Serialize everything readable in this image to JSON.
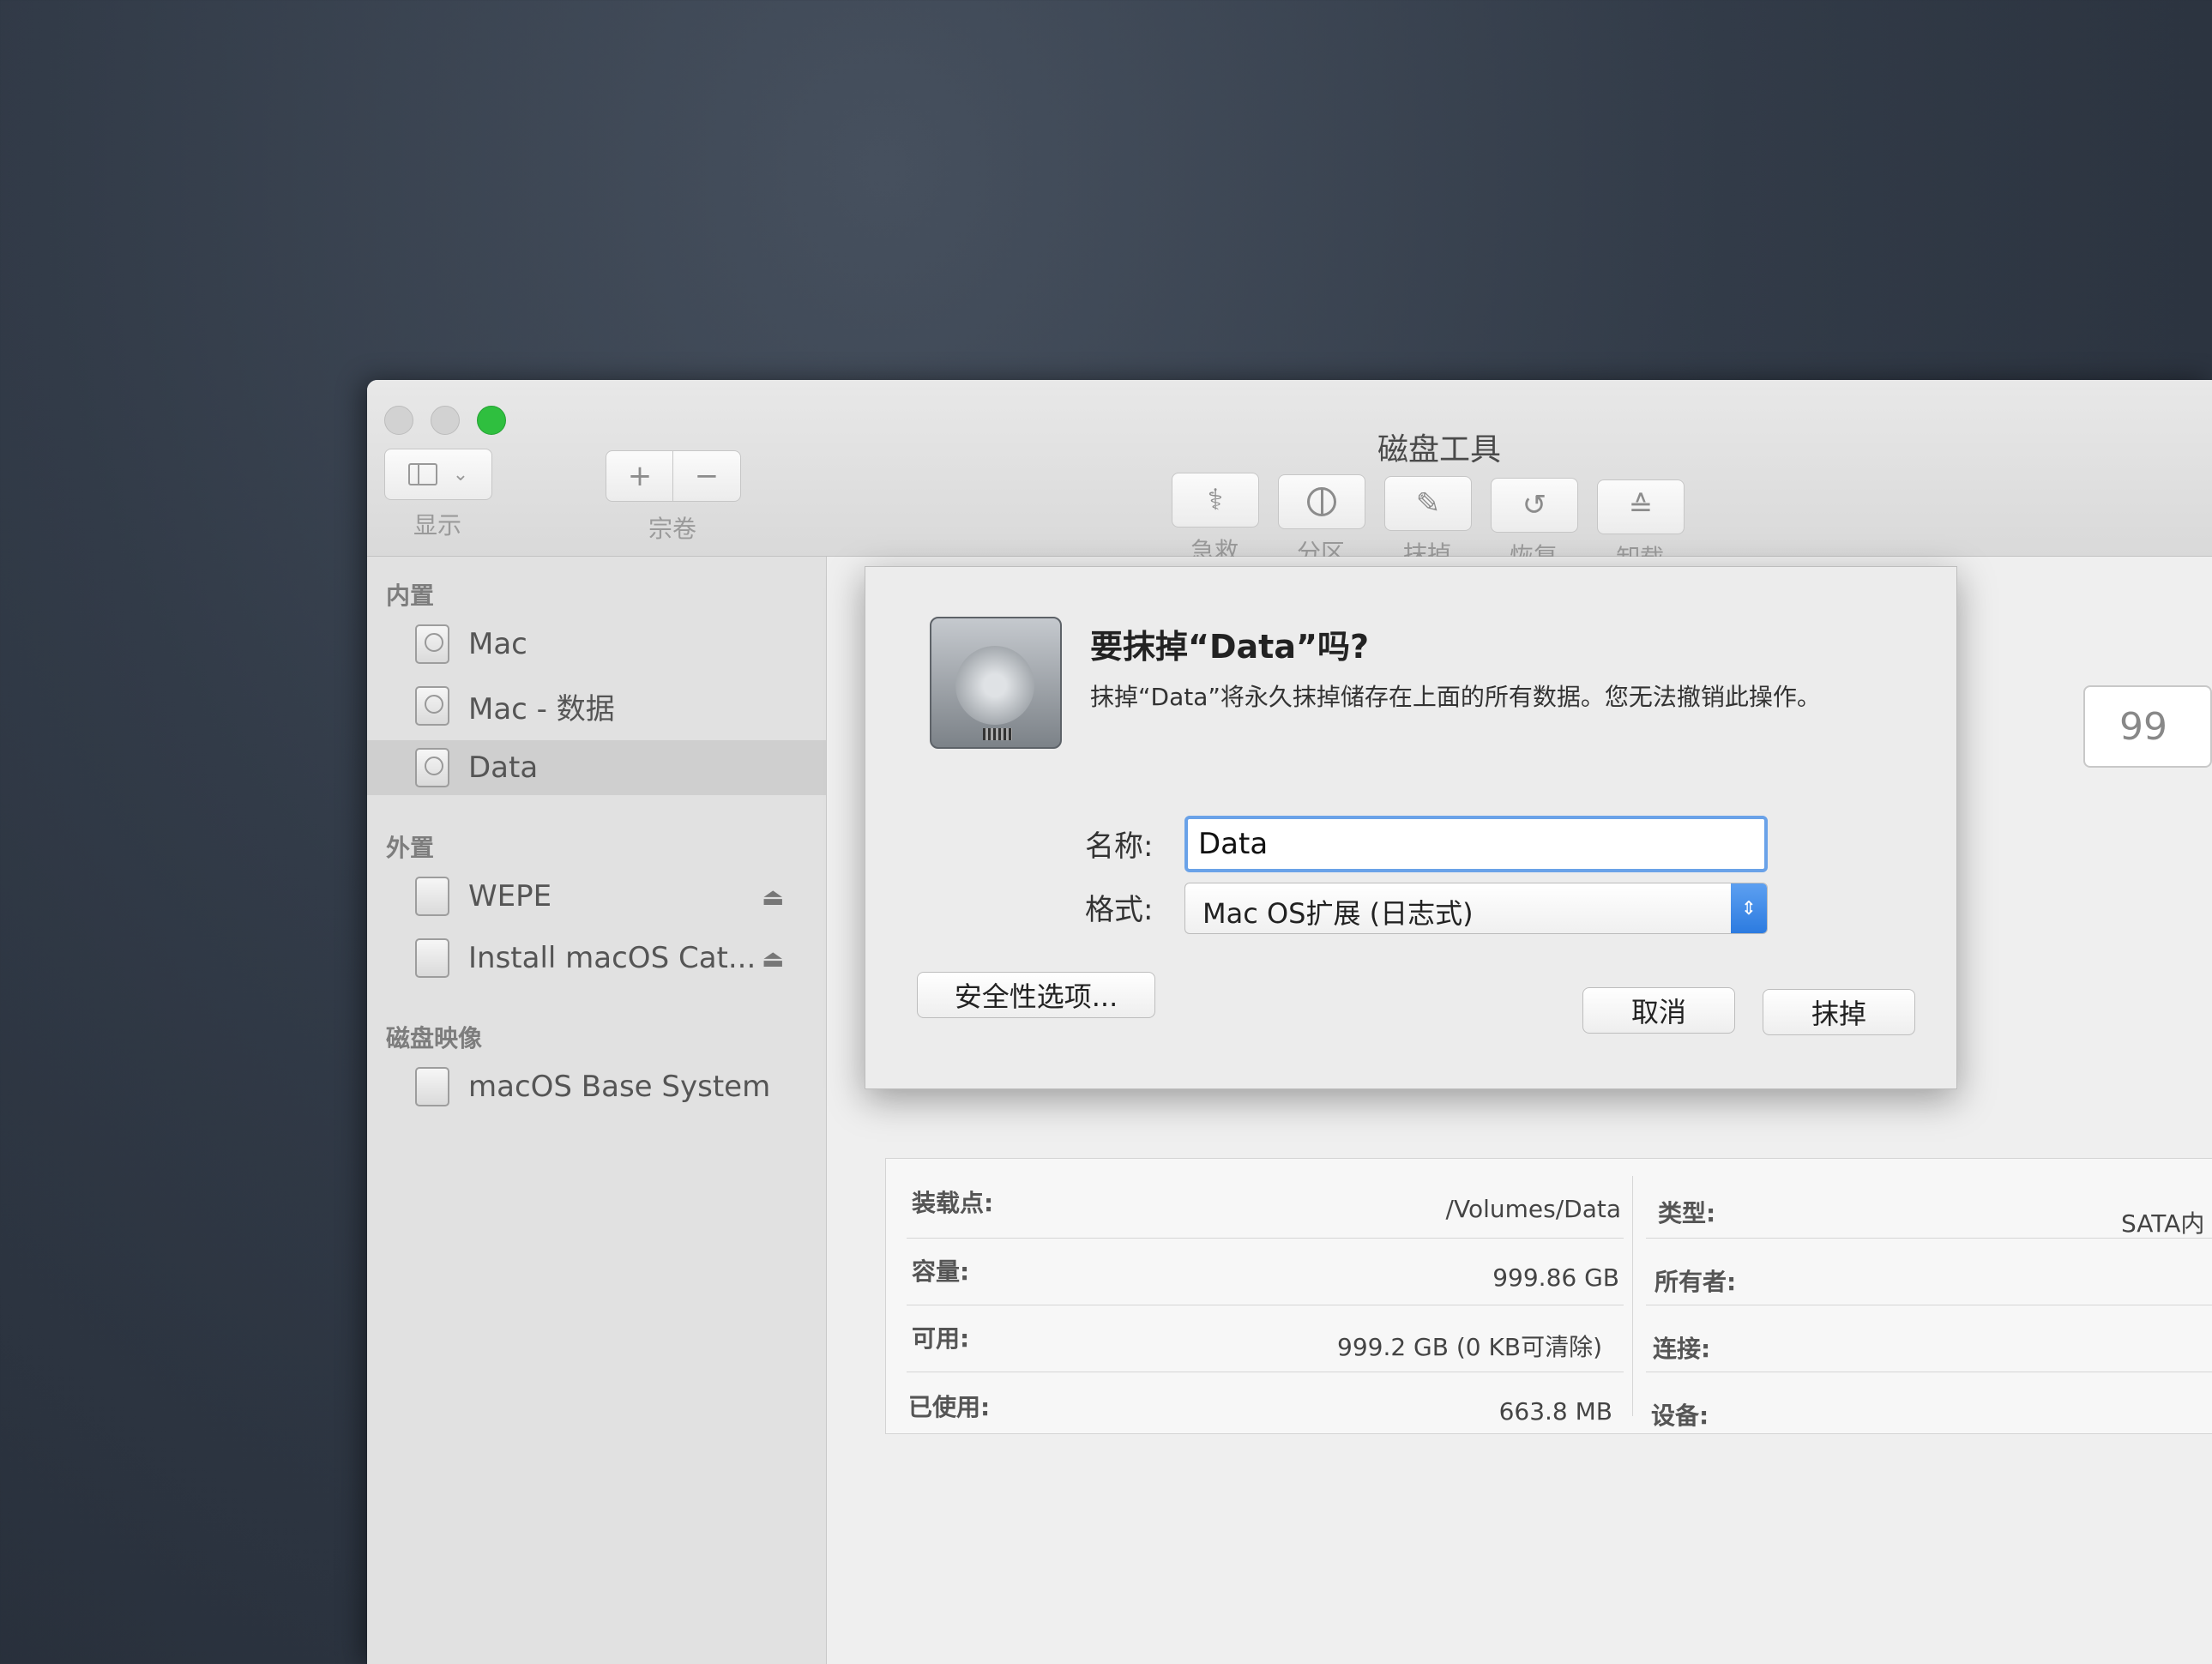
{
  "window": {
    "title": "磁盘工具"
  },
  "toolbar": {
    "view_label": "显示",
    "volume_label": "宗卷",
    "add_symbol": "+",
    "remove_symbol": "−",
    "items": [
      {
        "label": "急救",
        "icon": "stethoscope-icon"
      },
      {
        "label": "分区",
        "icon": "pie-chart-icon"
      },
      {
        "label": "抹掉",
        "icon": "erase-icon"
      },
      {
        "label": "恢复",
        "icon": "restore-icon"
      },
      {
        "label": "卸载",
        "icon": "unmount-icon"
      }
    ]
  },
  "sidebar": {
    "sections": [
      {
        "title": "内置",
        "items": [
          "Mac",
          "Mac - 数据",
          "Data"
        ]
      },
      {
        "title": "外置",
        "items": [
          "WEPE",
          "Install macOS Cat..."
        ]
      },
      {
        "title": "磁盘映像",
        "items": [
          "macOS Base System"
        ]
      }
    ],
    "selected": "Data",
    "eject_symbol": "⏏"
  },
  "dialog": {
    "title": "要抹掉“Data”吗?",
    "message": "抹掉“Data”将永久抹掉储存在上面的所有数据。您无法撤销此操作。",
    "name_label": "名称:",
    "name_value": "Data",
    "format_label": "格式:",
    "format_value": "Mac OS扩展 (日志式)",
    "security_button": "安全性选项...",
    "cancel_button": "取消",
    "erase_button": "抹掉"
  },
  "capacity_box": "99",
  "info": {
    "left": [
      {
        "key": "装载点:",
        "value": "/Volumes/Data"
      },
      {
        "key": "容量:",
        "value": "999.86 GB"
      },
      {
        "key": "可用:",
        "value": "999.2 GB (0 KB可清除)"
      },
      {
        "key": "已使用:",
        "value": "663.8 MB"
      }
    ],
    "right": [
      {
        "key": "类型:",
        "value": "SATA内"
      },
      {
        "key": "所有者:",
        "value": ""
      },
      {
        "key": "连接:",
        "value": ""
      },
      {
        "key": "设备:",
        "value": ""
      }
    ]
  }
}
